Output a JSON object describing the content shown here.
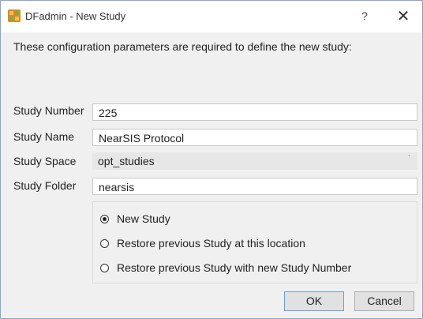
{
  "window": {
    "title": "DFadmin - New Study",
    "help_glyph": "?",
    "close_glyph": "✕",
    "app_icon": "dfadmin-app-icon"
  },
  "intro_text": "These configuration parameters are required to define the new study:",
  "fields": {
    "study_number": {
      "label": "Study Number",
      "value": "225"
    },
    "study_name": {
      "label": "Study Name",
      "value": "NearSIS Protocol"
    },
    "study_space": {
      "label": "Study Space",
      "value": "opt_studies",
      "arrow": "˙"
    },
    "study_folder": {
      "label": "Study Folder",
      "value": "nearsis"
    }
  },
  "options": [
    {
      "label": "New Study",
      "checked": true
    },
    {
      "label": "Restore previous Study at this location",
      "checked": false
    },
    {
      "label": "Restore previous Study with new Study Number",
      "checked": false
    }
  ],
  "buttons": {
    "ok": "OK",
    "cancel": "Cancel"
  },
  "colors": {
    "window_border": "#8fa3c2",
    "dialog_bg": "#f0f0f0",
    "default_button_border": "#6c9fd6"
  }
}
